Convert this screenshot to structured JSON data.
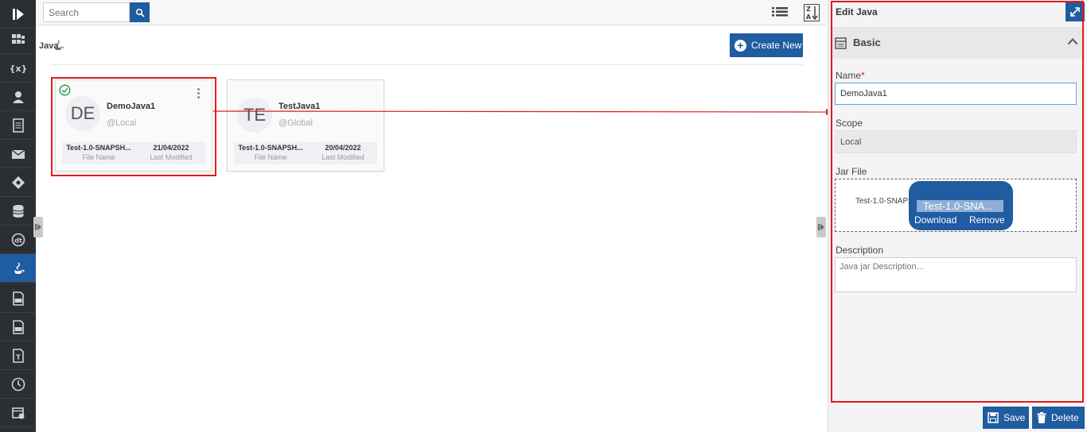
{
  "search": {
    "placeholder": "Search"
  },
  "breadcrumb": {
    "label": "Java"
  },
  "toolbar": {
    "create_label": "Create New"
  },
  "cards": [
    {
      "initials": "DE",
      "title": "DemoJava1",
      "scope": "@Local",
      "file_name_value": "Test-1.0-SNAPSH...",
      "file_name_key": "File Name",
      "modified_value": "21/04/2022",
      "modified_key": "Last Modified",
      "selected": true
    },
    {
      "initials": "TE",
      "title": "TestJava1",
      "scope": "@Global",
      "file_name_value": "Test-1.0-SNAPSH...",
      "file_name_key": "File Name",
      "modified_value": "20/04/2022",
      "modified_key": "Last Modified",
      "selected": false
    }
  ],
  "panel": {
    "title": "Edit Java",
    "section": "Basic",
    "name_label": "Name",
    "name_required": "*",
    "name_value": "DemoJava1",
    "scope_label": "Scope",
    "scope_value": "Local",
    "jar_label": "Jar File",
    "jar_file_name": "Test-1.0-SNAPSHOT.jar",
    "jar_popup_name": "Test-1.0-SNA...",
    "download_label": "Download",
    "remove_label": "Remove",
    "description_label": "Description",
    "description_placeholder": "Java jar Description...",
    "save_label": "Save",
    "delete_label": "Delete"
  },
  "nav": {
    "items": [
      "play-logo-icon",
      "dashboard-icon",
      "variables-icon",
      "user-icon",
      "document-icon",
      "mail-icon",
      "diamond-icon",
      "database-icon",
      "dt-icon",
      "java-icon",
      "json-file-icon",
      "css-file-icon",
      "text-file-icon",
      "clock-icon",
      "calendar-settings-icon"
    ],
    "active": "java-icon"
  },
  "colors": {
    "accent": "#1f5ca0",
    "highlight": "#e01b1b",
    "nav_bg": "#2b2f33",
    "success": "#2e9e5b"
  }
}
